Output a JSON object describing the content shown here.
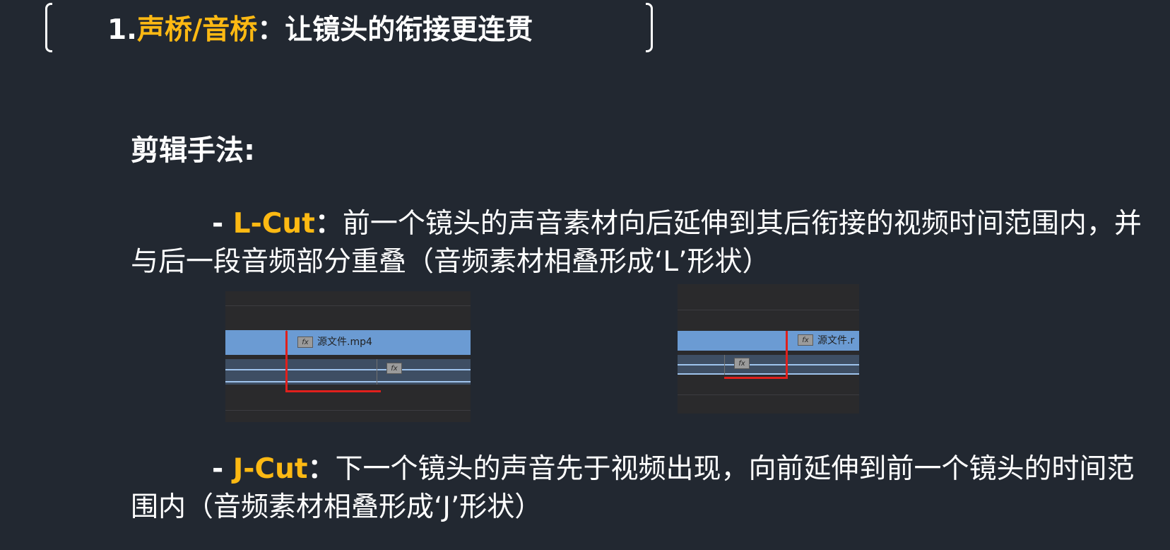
{
  "title": {
    "number": "1.",
    "highlight": "声桥/音桥",
    "rest": "：让镜头的衔接更连贯"
  },
  "method_heading": "剪辑手法:",
  "lcut": {
    "dash": "- ",
    "name": "L-Cut",
    "colon": "：",
    "description": "前一个镜头的声音素材向后延伸到其后衔接的视频时间范围内，并与后一段音频部分重叠（音频素材相叠形成‘L’形状）"
  },
  "jcut": {
    "dash": "- ",
    "name": "J-Cut",
    "colon": "：",
    "description": "下一个镜头的声音先于视频出现，向前延伸到前一个镜头的时间范围内（音频素材相叠形成‘J’形状）"
  },
  "timeline_left": {
    "clip_label": "源文件.mp4",
    "fx_label": "fx"
  },
  "timeline_right": {
    "clip_label": "源文件.r",
    "fx_label": "fx"
  },
  "colors": {
    "background": "#222831",
    "accent": "#FDB913",
    "text": "#ffffff",
    "video_clip": "#6b9bd3",
    "audio_track": "#3e4e63",
    "edit_marker": "#e0201c"
  }
}
